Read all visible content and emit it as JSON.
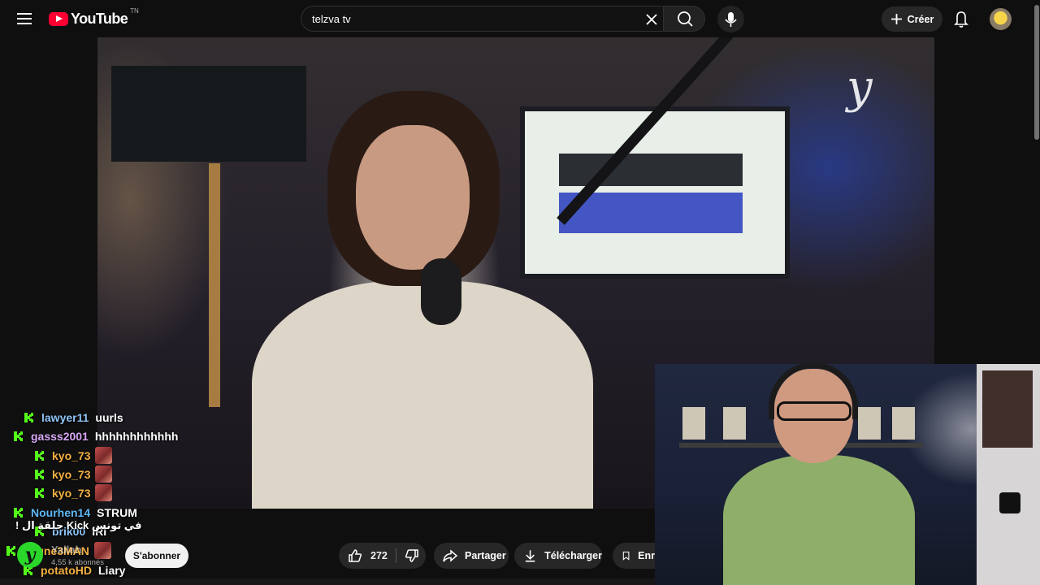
{
  "header": {
    "logo_text": "YouTube",
    "region_code": "TN",
    "search_value": "telzva tv",
    "create_label": "Créer"
  },
  "chat": {
    "messages": [
      {
        "user": "lawyer11",
        "text": "uurls",
        "color": "#8ec3f5",
        "emote": false
      },
      {
        "user": "gasss2001",
        "text": "hhhhhhhhhhhh",
        "color": "#d7a7f5",
        "emote": false
      },
      {
        "user": "kyo_73",
        "text": "",
        "color": "#f5b042",
        "emote": true
      },
      {
        "user": "kyo_73",
        "text": "",
        "color": "#f5b042",
        "emote": true
      },
      {
        "user": "kyo_73",
        "text": "",
        "color": "#f5b042",
        "emote": true
      },
      {
        "user": "Nourhen14",
        "text": "STRUM",
        "color": "#5fb7f5",
        "emote": false
      },
      {
        "user": "brik00",
        "text": "IRI",
        "color": "#8ec3f5",
        "emote": false
      },
      {
        "user": "youne3MAN",
        "text": "",
        "color": "#f5b042",
        "emote": true
      },
      {
        "user": "potatoHD",
        "text": "Liary",
        "color": "#f5b042",
        "emote": false
      }
    ],
    "overlay_line": "في تونس Kick حلقة ال !",
    "kick_color": "#53fc18"
  },
  "channel": {
    "name": "Yallah",
    "subscribers": "4,55 k abonnés",
    "subscribe_label": "S'abonner"
  },
  "actions": {
    "like_count": "272",
    "share_label": "Partager",
    "download_label": "Télécharger",
    "save_label": "Enr"
  },
  "video": {
    "brand_mark": "y"
  }
}
